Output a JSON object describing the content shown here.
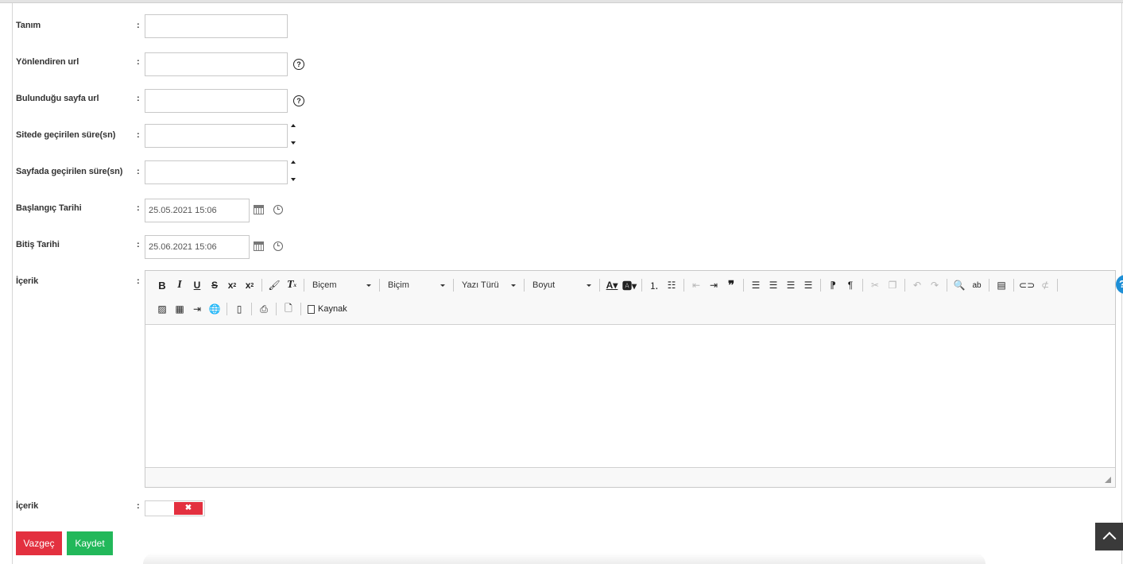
{
  "form": {
    "fields": [
      {
        "label": "Tanım",
        "value": "",
        "has_help": false,
        "type": "text"
      },
      {
        "label": "Yönlendiren url",
        "value": "",
        "has_help": true,
        "type": "text"
      },
      {
        "label": "Bulunduğu sayfa url",
        "value": "",
        "has_help": true,
        "type": "text"
      },
      {
        "label": "Sitede geçirilen süre(sn)",
        "value": "",
        "has_help": false,
        "type": "number"
      },
      {
        "label": "Sayfada geçirilen süre(sn)",
        "value": "",
        "has_help": false,
        "type": "number"
      },
      {
        "label": "Başlangıç Tarihi",
        "value": "25.05.2021 15:06",
        "has_help": false,
        "type": "datetime"
      },
      {
        "label": "Bitiş Tarihi",
        "value": "25.06.2021 15:06",
        "has_help": false,
        "type": "datetime"
      }
    ],
    "colon": ":",
    "help_glyph": "?",
    "content_label": "İçerik",
    "toggle_label": "İçerik",
    "toggle_state": "off",
    "toggle_glyph": "✖"
  },
  "editor": {
    "combos": {
      "style": "Biçem",
      "format": "Biçim",
      "font": "Yazı Türü",
      "size": "Boyut"
    },
    "source_label": "Kaynak",
    "buttons_row1": [
      "bold-icon",
      "italic-icon",
      "underline-icon",
      "strikethrough-icon",
      "subscript-icon",
      "superscript-icon",
      "copy-format-icon",
      "remove-format-icon",
      "text-color-icon",
      "background-color-icon",
      "numbered-list-icon",
      "bulleted-list-icon",
      "outdent-icon",
      "indent-icon",
      "blockquote-icon",
      "align-left-icon",
      "align-center-icon",
      "align-right-icon",
      "justify-icon",
      "ltr-icon",
      "rtl-icon",
      "cut-icon",
      "copy-icon",
      "undo-icon",
      "redo-icon",
      "find-icon",
      "replace-icon",
      "templates-icon",
      "link-icon",
      "unlink-icon"
    ],
    "buttons_row2": [
      "image-icon",
      "table-icon",
      "horizontal-rule-icon",
      "iframe-icon",
      "page-break-icon",
      "print-icon",
      "new-page-icon",
      "source-icon"
    ]
  },
  "actions": {
    "cancel": "Vazgeç",
    "save": "Kaydet"
  },
  "colors": {
    "cancel": "#e3303f",
    "save": "#22b85a",
    "toggle_off": "#e3303f",
    "info_bubble": "#1e8fd6"
  }
}
